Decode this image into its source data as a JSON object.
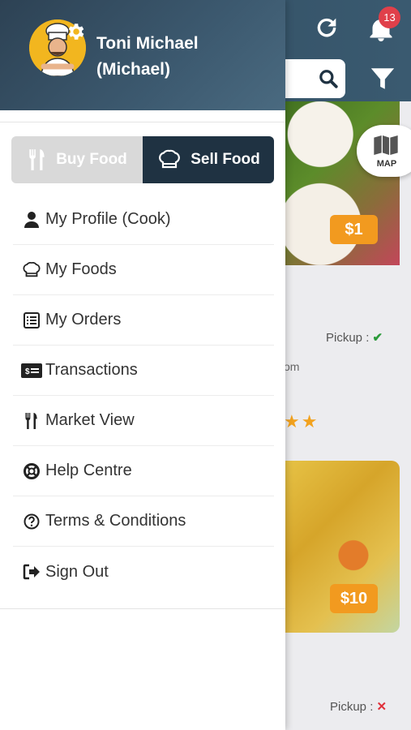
{
  "user": {
    "name": "Toni Michael (Michael)"
  },
  "toggle": {
    "buy_label": "Buy Food",
    "sell_label": "Sell Food"
  },
  "menu": [
    {
      "label": "My Profile (Cook)",
      "icon": "user-icon"
    },
    {
      "label": "My Foods",
      "icon": "chef-hat-icon"
    },
    {
      "label": "My Orders",
      "icon": "list-icon"
    },
    {
      "label": "Transactions",
      "icon": "card-icon"
    },
    {
      "label": "Market View",
      "icon": "utensils-icon"
    },
    {
      "label": "Help Centre",
      "icon": "lifebuoy-icon"
    },
    {
      "label": "Terms & Conditions",
      "icon": "question-icon"
    },
    {
      "label": "Sign Out",
      "icon": "sign-out-icon"
    }
  ],
  "background": {
    "notification_count": "13",
    "map_label": "MAP",
    "price_1": "$1",
    "price_2": "$10",
    "pickup_label": "Pickup :",
    "pickup_yes": "✔",
    "pickup_no": "✕",
    "partial_text": "om",
    "stars": "★★"
  },
  "colors": {
    "header": "#2f4a5e",
    "accent_orange": "#f29a1f",
    "toggle_active": "#1f3242",
    "badge_red": "#e0404a"
  }
}
